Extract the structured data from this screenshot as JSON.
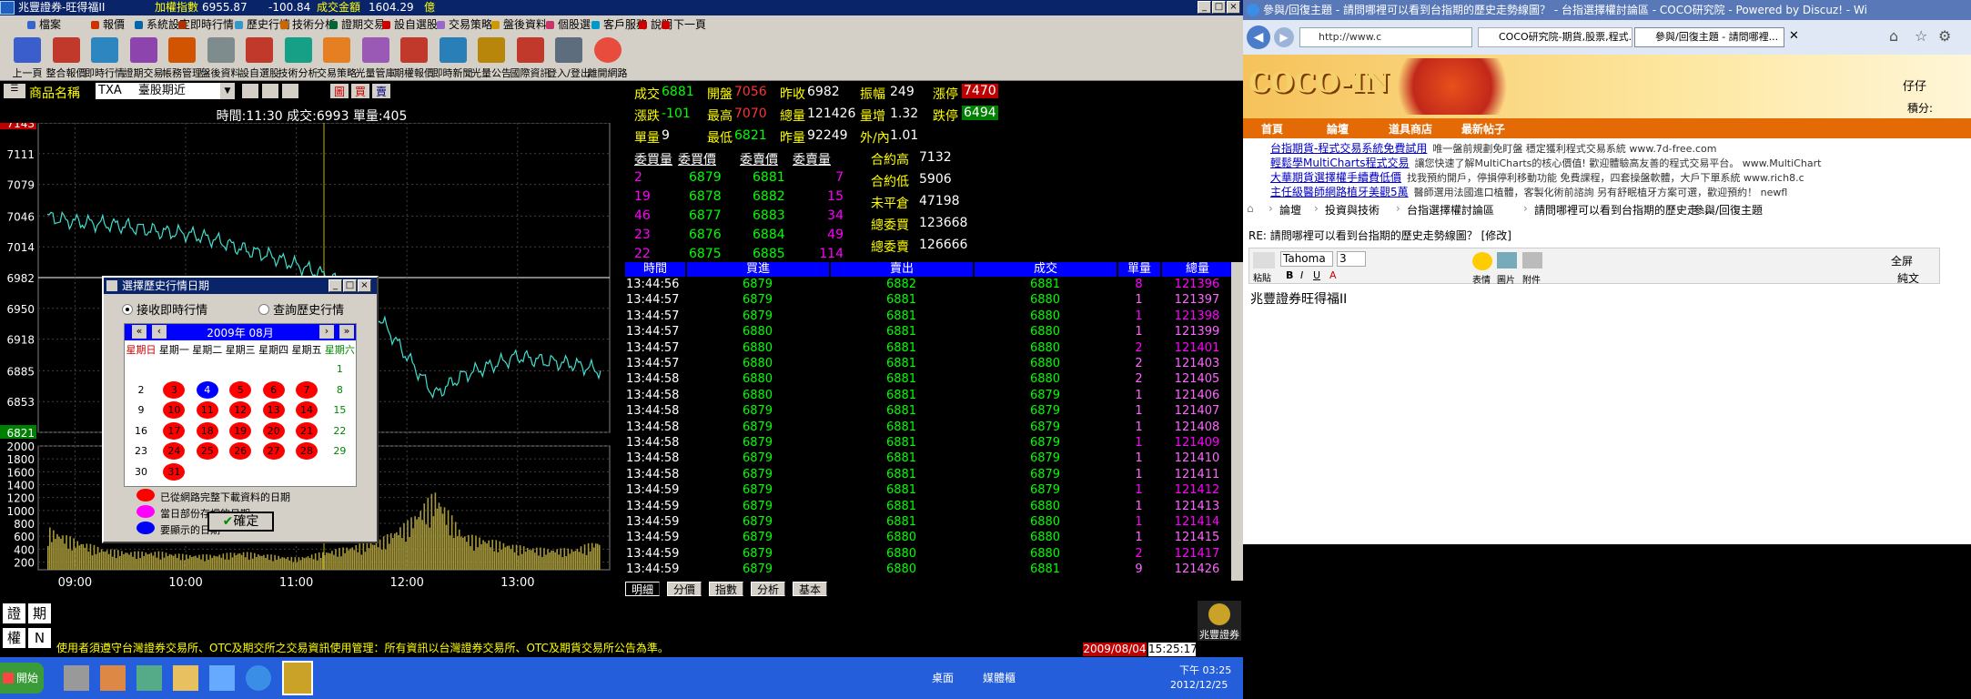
{
  "titlebar": {
    "app": "兆豐證券-旺得福II",
    "index_label": "加權指數",
    "index_value": "6955.87",
    "change": "-100.84",
    "amount_label": "成交金額",
    "amount_value": "1604.29",
    "unit": "億"
  },
  "menu": [
    "檔案",
    "報價",
    "系統設定",
    "即時行情",
    "歷史行情",
    "技術分析",
    "證期交易",
    "設自選股",
    "交易策略",
    "盤後資料",
    "個股選",
    "客戶服務",
    "說明",
    "下一頁"
  ],
  "toolbar": [
    "上一頁",
    "整合報價",
    "即時行情",
    "證期交易",
    "帳務管理",
    "盤後資料",
    "設自選股",
    "技術分析",
    "交易策略",
    "光量管庫",
    "期權報價",
    "即時新聞",
    "光量公告",
    "國際資訊",
    "登入/登出",
    "離開網路"
  ],
  "product": {
    "label": "商品名稱",
    "code": "TXA",
    "name": "臺股期近",
    "b1": "圖",
    "b2": "買",
    "b3": "賣"
  },
  "chart_header": "時間:11:30  成交:6993  單量:405",
  "chart_data": {
    "type": "line",
    "price_ticks": [
      "7143",
      "7111",
      "7079",
      "7046",
      "7014",
      "6982",
      "6950",
      "6918",
      "6885",
      "6853",
      "6821"
    ],
    "price_top": "7143",
    "price_ref": "6982",
    "price_low": "6821",
    "ylim": [
      6821,
      7143
    ],
    "volume_ticks": [
      "2000",
      "1800",
      "1600",
      "1400",
      "1200",
      "1000",
      "800",
      "600",
      "400",
      "200"
    ],
    "time_ticks": [
      "09:00",
      "10:00",
      "11:00",
      "12:00",
      "13:00"
    ],
    "x_minutes": [
      0,
      15,
      30,
      45,
      60,
      75,
      90,
      105,
      120,
      135,
      150,
      165,
      180,
      195,
      210,
      225,
      240,
      255,
      270,
      285,
      300
    ],
    "y": [
      7045,
      7040,
      7038,
      7035,
      7030,
      7028,
      7022,
      7012,
      7005,
      6995,
      6985,
      6970,
      6940,
      6900,
      6860,
      6880,
      6890,
      6900,
      6895,
      6892,
      6885
    ],
    "vol": [
      700,
      500,
      350,
      300,
      300,
      250,
      250,
      300,
      250,
      200,
      300,
      400,
      500,
      800,
      1300,
      600,
      500,
      400,
      350,
      350,
      500
    ]
  },
  "quote": {
    "cjlabel": "成交",
    "cj": "6881",
    "kplabel": "開盤",
    "kp": "7056",
    "zslabel": "昨收",
    "zs": "6982",
    "zflabel": "振幅",
    "zf": "249",
    "ztlabel": "漲停",
    "zt": "7470",
    "zdlabel": "漲跌",
    "zd": "-101",
    "zglabel": "最高",
    "zg": "7070",
    "zllabel": "總量",
    "zl": "121426",
    "lblabel": "量增",
    "lb": "1.32",
    "dtlabel": "跌停",
    "dt": "6494",
    "dllabel": "單量",
    "dl": "9",
    "zdjlabel": "最低",
    "zdj": "6821",
    "zrllabel": "昨量",
    "zrl": "92249",
    "wnlabel": "外/內",
    "wn": "1.01",
    "hdr": [
      "委買量",
      "委買價",
      "委賣價",
      "委賣量"
    ],
    "book": [
      [
        "2",
        "6879",
        "6881",
        "7"
      ],
      [
        "19",
        "6878",
        "6882",
        "15"
      ],
      [
        "46",
        "6877",
        "6883",
        "34"
      ],
      [
        "23",
        "6876",
        "6884",
        "49"
      ],
      [
        "22",
        "6875",
        "6885",
        "114"
      ]
    ],
    "stats": [
      [
        "合約高",
        "7132"
      ],
      [
        "合約低",
        "5906"
      ],
      [
        "未平倉",
        "47198"
      ],
      [
        "總委買",
        "123668"
      ],
      [
        "總委賣",
        "126666"
      ]
    ]
  },
  "ticks_header": [
    "時間",
    "買進",
    "賣出",
    "成交",
    "單量",
    "總量"
  ],
  "ticks": [
    [
      "13:44:56",
      "6879",
      "6882",
      "6881",
      "8",
      "121396"
    ],
    [
      "13:44:57",
      "6879",
      "6881",
      "6880",
      "1",
      "121397"
    ],
    [
      "13:44:57",
      "6879",
      "6881",
      "6880",
      "1",
      "121398"
    ],
    [
      "13:44:57",
      "6880",
      "6881",
      "6880",
      "1",
      "121399"
    ],
    [
      "13:44:57",
      "6880",
      "6881",
      "6880",
      "2",
      "121401"
    ],
    [
      "13:44:57",
      "6880",
      "6881",
      "6880",
      "2",
      "121403"
    ],
    [
      "13:44:58",
      "6880",
      "6881",
      "6880",
      "2",
      "121405"
    ],
    [
      "13:44:58",
      "6880",
      "6881",
      "6879",
      "1",
      "121406"
    ],
    [
      "13:44:58",
      "6879",
      "6881",
      "6879",
      "1",
      "121407"
    ],
    [
      "13:44:58",
      "6879",
      "6881",
      "6879",
      "1",
      "121408"
    ],
    [
      "13:44:58",
      "6879",
      "6881",
      "6879",
      "1",
      "121409"
    ],
    [
      "13:44:58",
      "6879",
      "6881",
      "6879",
      "1",
      "121410"
    ],
    [
      "13:44:58",
      "6879",
      "6881",
      "6879",
      "1",
      "121411"
    ],
    [
      "13:44:59",
      "6879",
      "6881",
      "6879",
      "1",
      "121412"
    ],
    [
      "13:44:59",
      "6879",
      "6881",
      "6880",
      "1",
      "121413"
    ],
    [
      "13:44:59",
      "6879",
      "6881",
      "6880",
      "1",
      "121414"
    ],
    [
      "13:44:59",
      "6879",
      "6880",
      "6880",
      "1",
      "121415"
    ],
    [
      "13:44:59",
      "6879",
      "6880",
      "6880",
      "2",
      "121417"
    ],
    [
      "13:44:59",
      "6879",
      "6880",
      "6881",
      "9",
      "121426"
    ]
  ],
  "tabs": [
    "明細",
    "分價",
    "指數",
    "分析",
    "基本"
  ],
  "dialog": {
    "title": "選擇歷史行情日期",
    "opt1": "接收即時行情",
    "opt2": "查詢歷史行情",
    "month": "2009年 08月",
    "weekdays": [
      "星期日",
      "星期一",
      "星期二",
      "星期三",
      "星期四",
      "星期五",
      "星期六"
    ],
    "days": [
      [
        "",
        "",
        "",
        "",
        "",
        "",
        "1"
      ],
      [
        "2",
        "3",
        "4",
        "5",
        "6",
        "7",
        "8"
      ],
      [
        "9",
        "10",
        "11",
        "12",
        "13",
        "14",
        "15"
      ],
      [
        "16",
        "17",
        "18",
        "19",
        "20",
        "21",
        "22"
      ],
      [
        "23",
        "24",
        "25",
        "26",
        "27",
        "28",
        "29"
      ],
      [
        "30",
        "31",
        "",
        "",
        "",
        "",
        ""
      ]
    ],
    "legend1": "已從網路完整下載資料的日期",
    "legend2": "當日部份存檔的日期",
    "legend3": "要顯示的日期",
    "ok": "確定"
  },
  "bottom": {
    "k1": "證",
    "k2": "期",
    "k3": "權",
    "k4": "N",
    "ticker": "使用者須遵守台灣證券交易所、OTC及期交所之交易資訊使用管理：所有資訊以台灣證券交易所、OTC及期貨交易所公告為準。",
    "date": "2009/08/04",
    "time": "15:25:17",
    "brand": "兆豐證券"
  },
  "ie": {
    "title": "參與/回復主題 - 請問哪裡可以看到台指期的歷史走勢線圖？ - 台指選擇權討論區 - COCO研究院 - Powered by Discuz! - Wi",
    "url": "http://www.c",
    "tab1": "COCO研究院-期貨,股票,程式...",
    "tab2": "參與/回復主題 - 請問哪裡...",
    "logo": "COCO-IN",
    "user": "仔仔",
    "points": "積分:",
    "nav": [
      "首頁",
      "論壇",
      "道具商店",
      "最新帖子"
    ],
    "ads": [
      [
        "台指期貨-程式交易系統免費試用",
        "唯一盤前規劃免盯盤 穩定獲利程式交易系統 www.7d-free.com"
      ],
      [
        "輕鬆學MultiCharts程式交易",
        "讓您快速了解MultiCharts的核心價值! 歡迎體驗高友善的程式交易平台。 www.MultiChart"
      ],
      [
        "大華期貨選擇權手續費低價",
        "找我預約開戶，停損停利移動功能 免費課程，四套操盤軟體，大戶下單系統 www.rich8.c"
      ],
      [
        "主任級醫師網路植牙美觀5萬",
        "醫師選用法國進口植體，客製化術前諮詢 另有舒眠植牙方案可選，歡迎預約！ newfl"
      ]
    ],
    "crumbs": [
      "論壇",
      "投資與技術",
      "台指選擇權討論區",
      "請問哪裡可以看到台指期的歷史走 ...",
      "參與/回復主題"
    ],
    "re": "RE: 請問哪裡可以看到台指期的歷史走勢線圖？ [修改]",
    "font": "Tahoma",
    "size": "3",
    "paste": "粘貼",
    "e1": "表情",
    "e2": "圖片",
    "e3": "附件",
    "full": "全屏",
    "plain": "純文",
    "body": "兆豐證券旺得福II"
  },
  "taskbar": {
    "start": "開始",
    "desk": "桌面",
    "media": "媒體櫃",
    "time": "下午 03:25",
    "date": "2012/12/25"
  }
}
